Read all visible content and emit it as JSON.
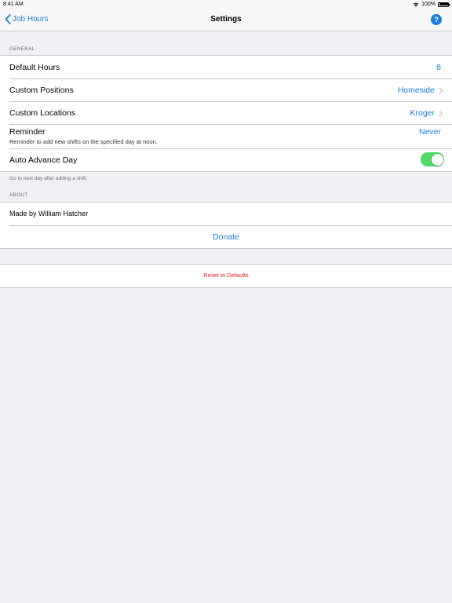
{
  "status_bar": {
    "time": "8:41 AM",
    "battery": "100%",
    "battery_level": 1.0,
    "icons": [
      "wifi-icon",
      "battery-icon"
    ]
  },
  "nav": {
    "back_label": "Job Hours",
    "title": "Settings",
    "help_label": "?"
  },
  "general": {
    "header": "GENERAL",
    "default_hours": {
      "label": "Default Hours",
      "value": "8"
    },
    "custom_positions": {
      "label": "Custom Positions",
      "value": "Homeside"
    },
    "custom_locations": {
      "label": "Custom Locations",
      "value": "Kroger"
    },
    "reminder": {
      "label": "Reminder",
      "value": "Never",
      "subtitle": "Reminder to add new shifts on the specified day at noon."
    },
    "auto_advance": {
      "label": "Auto Advance Day",
      "enabled": true
    },
    "footer": "Go to next day after adding a shift."
  },
  "about": {
    "header": "ABOUT",
    "made_by": "Made by William Hatcher",
    "donate_label": "Donate"
  },
  "reset": {
    "label": "Reset to Defaults"
  },
  "colors": {
    "accent": "#1a7fde",
    "toggle_on": "#4cd964",
    "destructive": "#e02020",
    "background": "#efeff4"
  }
}
